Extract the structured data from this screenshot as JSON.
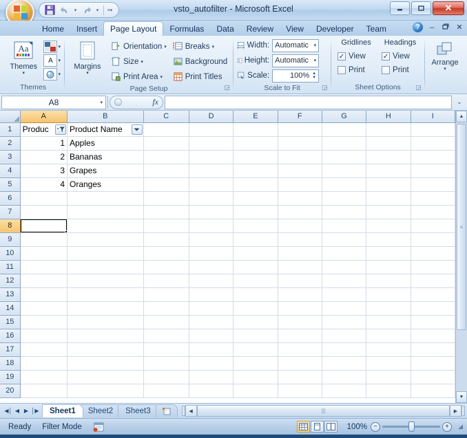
{
  "window": {
    "title": "vsto_autofilter - Microsoft Excel",
    "minimize_label": "–",
    "restore_label": "□",
    "close_label": "✕"
  },
  "quick_access": {
    "save_label": "save-icon",
    "undo_label": "↶",
    "redo_label": "↷",
    "customize_label": "▾"
  },
  "office_button": {
    "label": "Office"
  },
  "tabs": [
    {
      "label": "Home",
      "active": false
    },
    {
      "label": "Insert",
      "active": false
    },
    {
      "label": "Page Layout",
      "active": true
    },
    {
      "label": "Formulas",
      "active": false
    },
    {
      "label": "Data",
      "active": false
    },
    {
      "label": "Review",
      "active": false
    },
    {
      "label": "View",
      "active": false
    },
    {
      "label": "Developer",
      "active": false
    },
    {
      "label": "Team",
      "active": false
    }
  ],
  "tab_right": {
    "help_label": "?",
    "minimize_label": "–",
    "restore_label": "❐",
    "close_label": "✕"
  },
  "ribbon": {
    "groups": [
      {
        "name": "Themes",
        "label": "Themes",
        "big_button": {
          "label": "Themes",
          "caret": "▾"
        },
        "mini_buttons": [
          {
            "name": "theme-colors",
            "glyph": "",
            "caret": "▾"
          },
          {
            "name": "theme-fonts",
            "glyph": "A",
            "caret": "▾"
          },
          {
            "name": "theme-effects",
            "glyph": "",
            "caret": "▾"
          }
        ]
      },
      {
        "name": "Page Setup",
        "label": "Page Setup",
        "big_button": {
          "label": "Margins",
          "caret": "▾"
        },
        "items_col1": [
          {
            "label": "Orientation",
            "caret": "▾"
          },
          {
            "label": "Size",
            "caret": "▾"
          },
          {
            "label": "Print Area",
            "caret": "▾"
          }
        ],
        "items_col2": [
          {
            "label": "Breaks",
            "caret": "▾"
          },
          {
            "label": "Background",
            "caret": ""
          },
          {
            "label": "Print Titles",
            "caret": ""
          }
        ],
        "launcher": "◲"
      },
      {
        "name": "Scale to Fit",
        "label": "Scale to Fit",
        "rows": [
          {
            "label": "Width:",
            "value": "Automatic",
            "caret": "▾",
            "type": "combo"
          },
          {
            "label": "Height:",
            "value": "Automatic",
            "caret": "▾",
            "type": "combo"
          },
          {
            "label": "Scale:",
            "value": "100%",
            "caret": "",
            "type": "spinner"
          }
        ],
        "launcher": "◲"
      },
      {
        "name": "Sheet Options",
        "label": "Sheet Options",
        "columns": [
          {
            "header": "Gridlines",
            "options": [
              {
                "label": "View",
                "checked": true
              },
              {
                "label": "Print",
                "checked": false
              }
            ]
          },
          {
            "header": "Headings",
            "options": [
              {
                "label": "View",
                "checked": true
              },
              {
                "label": "Print",
                "checked": false
              }
            ]
          }
        ],
        "launcher": "◲"
      },
      {
        "name": "Arrange",
        "label": "",
        "big_button": {
          "label": "Arrange",
          "caret": "▾"
        }
      }
    ]
  },
  "formula_bar": {
    "name_box_value": "A8",
    "name_box_caret": "▾",
    "fx_label": "fx",
    "formula_value": "",
    "expand_caret": "⌄"
  },
  "grid": {
    "columns": [
      "A",
      "B",
      "C",
      "D",
      "E",
      "F",
      "G",
      "H",
      "I"
    ],
    "selected_column": "A",
    "selected_row": 8,
    "selected_cell": "A8",
    "rows": [
      {
        "num": "1",
        "cells": [
          {
            "text": "Produc",
            "type": "header",
            "filter": "funnel"
          },
          {
            "text": "Product Name",
            "type": "header",
            "filter": "arrow"
          },
          {
            "text": ""
          },
          {
            "text": ""
          },
          {
            "text": ""
          },
          {
            "text": ""
          },
          {
            "text": ""
          },
          {
            "text": ""
          },
          {
            "text": ""
          }
        ]
      },
      {
        "num": "2",
        "cells": [
          {
            "text": "1",
            "type": "number"
          },
          {
            "text": "Apples"
          },
          {
            "text": ""
          },
          {
            "text": ""
          },
          {
            "text": ""
          },
          {
            "text": ""
          },
          {
            "text": ""
          },
          {
            "text": ""
          },
          {
            "text": ""
          }
        ]
      },
      {
        "num": "3",
        "cells": [
          {
            "text": "2",
            "type": "number"
          },
          {
            "text": "Bananas"
          },
          {
            "text": ""
          },
          {
            "text": ""
          },
          {
            "text": ""
          },
          {
            "text": ""
          },
          {
            "text": ""
          },
          {
            "text": ""
          },
          {
            "text": ""
          }
        ]
      },
      {
        "num": "4",
        "cells": [
          {
            "text": "3",
            "type": "number"
          },
          {
            "text": "Grapes"
          },
          {
            "text": ""
          },
          {
            "text": ""
          },
          {
            "text": ""
          },
          {
            "text": ""
          },
          {
            "text": ""
          },
          {
            "text": ""
          },
          {
            "text": ""
          }
        ]
      },
      {
        "num": "5",
        "cells": [
          {
            "text": "4",
            "type": "number"
          },
          {
            "text": "Oranges"
          },
          {
            "text": ""
          },
          {
            "text": ""
          },
          {
            "text": ""
          },
          {
            "text": ""
          },
          {
            "text": ""
          },
          {
            "text": ""
          },
          {
            "text": ""
          }
        ]
      },
      {
        "num": "6",
        "cells": []
      },
      {
        "num": "7",
        "cells": []
      },
      {
        "num": "8",
        "cells": []
      },
      {
        "num": "9",
        "cells": []
      },
      {
        "num": "10",
        "cells": []
      },
      {
        "num": "11",
        "cells": []
      },
      {
        "num": "12",
        "cells": []
      },
      {
        "num": "13",
        "cells": []
      },
      {
        "num": "14",
        "cells": []
      },
      {
        "num": "15",
        "cells": []
      },
      {
        "num": "16",
        "cells": []
      },
      {
        "num": "17",
        "cells": []
      },
      {
        "num": "18",
        "cells": []
      },
      {
        "num": "19",
        "cells": []
      },
      {
        "num": "20",
        "cells": []
      }
    ]
  },
  "sheet_tabs": {
    "nav": [
      "◀│",
      "◀",
      "▶",
      "│▶"
    ],
    "tabs": [
      {
        "label": "Sheet1",
        "active": true
      },
      {
        "label": "Sheet2",
        "active": false
      },
      {
        "label": "Sheet3",
        "active": false
      }
    ],
    "insert_tab_label": "insert-sheet-icon"
  },
  "status_bar": {
    "mode": "Ready",
    "filter_mode": "Filter Mode",
    "macro_record_label": "macro-record-icon",
    "views": [
      {
        "name": "normal-view",
        "active": true
      },
      {
        "name": "page-layout-view",
        "active": false
      },
      {
        "name": "page-break-preview",
        "active": false
      }
    ],
    "zoom": "100%",
    "zoom_out_label": "−",
    "zoom_in_label": "+"
  },
  "colors": {
    "accent": "#1f4a7a",
    "selection_header": "#f5c571",
    "close_button": "#c43a26",
    "sheet_active": "#10355c"
  }
}
